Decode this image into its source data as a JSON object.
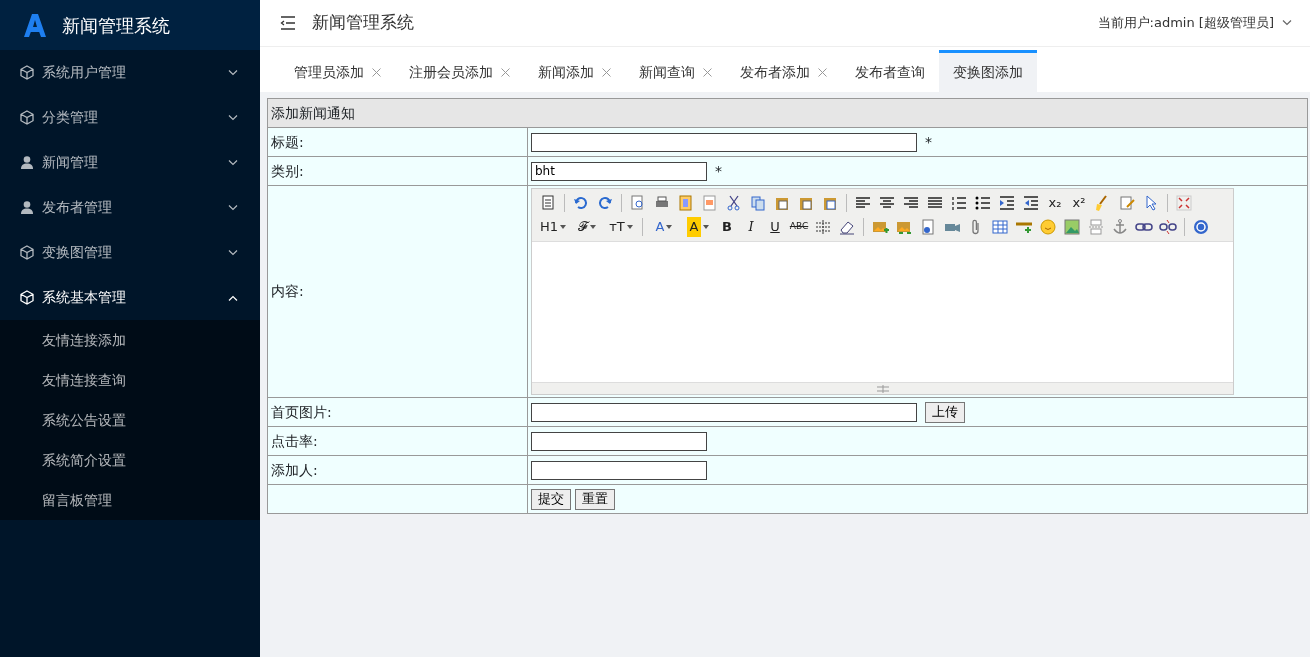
{
  "sidebar": {
    "logo_text": "新闻管理系统",
    "items": [
      {
        "label": "系统用户管理",
        "expanded": false
      },
      {
        "label": "分类管理",
        "expanded": false
      },
      {
        "label": "新闻管理",
        "expanded": false
      },
      {
        "label": "发布者管理",
        "expanded": false
      },
      {
        "label": "变换图管理",
        "expanded": false
      },
      {
        "label": "系统基本管理",
        "expanded": true,
        "children": [
          {
            "label": "友情连接添加"
          },
          {
            "label": "友情连接查询"
          },
          {
            "label": "系统公告设置"
          },
          {
            "label": "系统简介设置"
          },
          {
            "label": "留言板管理"
          }
        ]
      }
    ]
  },
  "header": {
    "title": "新闻管理系统",
    "user": "当前用户:admin [超级管理员]"
  },
  "tabs": [
    {
      "label": "管理员添加",
      "selected": false,
      "kind": "closable"
    },
    {
      "label": "注册会员添加",
      "selected": false,
      "kind": "closable"
    },
    {
      "label": "新闻添加",
      "selected": false,
      "kind": "closable"
    },
    {
      "label": "新闻查询",
      "selected": false,
      "kind": "closable"
    },
    {
      "label": "发布者添加",
      "selected": false,
      "kind": "closable"
    },
    {
      "label": "发布者查询",
      "selected": false,
      "kind": "fixed"
    },
    {
      "label": "变换图添加",
      "selected": true,
      "kind": "fixed"
    }
  ],
  "form": {
    "title": "添加新闻通知",
    "rows": [
      {
        "label": "标题:",
        "kind": "wide_input",
        "value": "",
        "required": "*"
      },
      {
        "label": "类别:",
        "kind": "input",
        "value": "bht",
        "required": "*"
      },
      {
        "label": "内容:",
        "kind": "editor",
        "toolbar": [
          [
            {
              "kind": "icon"
            },
            {
              "kind": "sep"
            },
            {
              "kind": "icon"
            },
            {
              "kind": "icon"
            },
            {
              "kind": "sep"
            },
            {
              "kind": "icon"
            },
            {
              "kind": "icon"
            },
            {
              "kind": "icon"
            },
            {
              "kind": "icon"
            },
            {
              "kind": "icon"
            },
            {
              "kind": "icon"
            },
            {
              "kind": "icon"
            },
            {
              "kind": "icon"
            },
            {
              "kind": "icon"
            },
            {
              "kind": "sep"
            },
            {
              "kind": "icon"
            },
            {
              "kind": "icon"
            },
            {
              "kind": "icon"
            },
            {
              "kind": "icon"
            },
            {
              "kind": "icon"
            },
            {
              "kind": "icon"
            },
            {
              "kind": "icon"
            },
            {
              "kind": "icon"
            },
            {
              "kind": "text",
              "label": "x₂"
            },
            {
              "kind": "text",
              "label": "x²"
            },
            {
              "kind": "icon"
            },
            {
              "kind": "icon"
            },
            {
              "kind": "icon"
            },
            {
              "kind": "sep"
            },
            {
              "kind": "icon"
            }
          ],
          [
            {
              "kind": "dropdown",
              "label": "H1"
            },
            {
              "kind": "dropdown",
              "label": "𝓕"
            },
            {
              "kind": "dropdown",
              "label": "тT"
            },
            {
              "kind": "sep"
            },
            {
              "kind": "color_dropdown",
              "label": "A"
            },
            {
              "kind": "highlight_dropdown",
              "label": "A"
            },
            {
              "kind": "bold",
              "label": "B"
            },
            {
              "kind": "italic",
              "label": "I"
            },
            {
              "kind": "underline",
              "label": "U"
            },
            {
              "kind": "strike",
              "label": "ABC"
            },
            {
              "kind": "icon"
            },
            {
              "kind": "icon"
            },
            {
              "kind": "sep"
            },
            {
              "kind": "icon"
            },
            {
              "kind": "icon"
            },
            {
              "kind": "icon"
            },
            {
              "kind": "icon"
            },
            {
              "kind": "icon"
            },
            {
              "kind": "icon"
            },
            {
              "kind": "icon"
            },
            {
              "kind": "icon"
            },
            {
              "kind": "icon"
            },
            {
              "kind": "icon"
            },
            {
              "kind": "icon"
            },
            {
              "kind": "icon"
            },
            {
              "kind": "icon"
            },
            {
              "kind": "sep"
            },
            {
              "kind": "icon"
            }
          ]
        ]
      },
      {
        "label": "首页图片:",
        "kind": "wide_input",
        "value": "",
        "button": "上传"
      },
      {
        "label": "点击率:",
        "kind": "input",
        "value": ""
      },
      {
        "label": "添加人:",
        "kind": "input",
        "value": ""
      },
      {
        "label": "",
        "kind": "actions",
        "buttons": [
          "提交",
          "重置"
        ]
      }
    ]
  }
}
